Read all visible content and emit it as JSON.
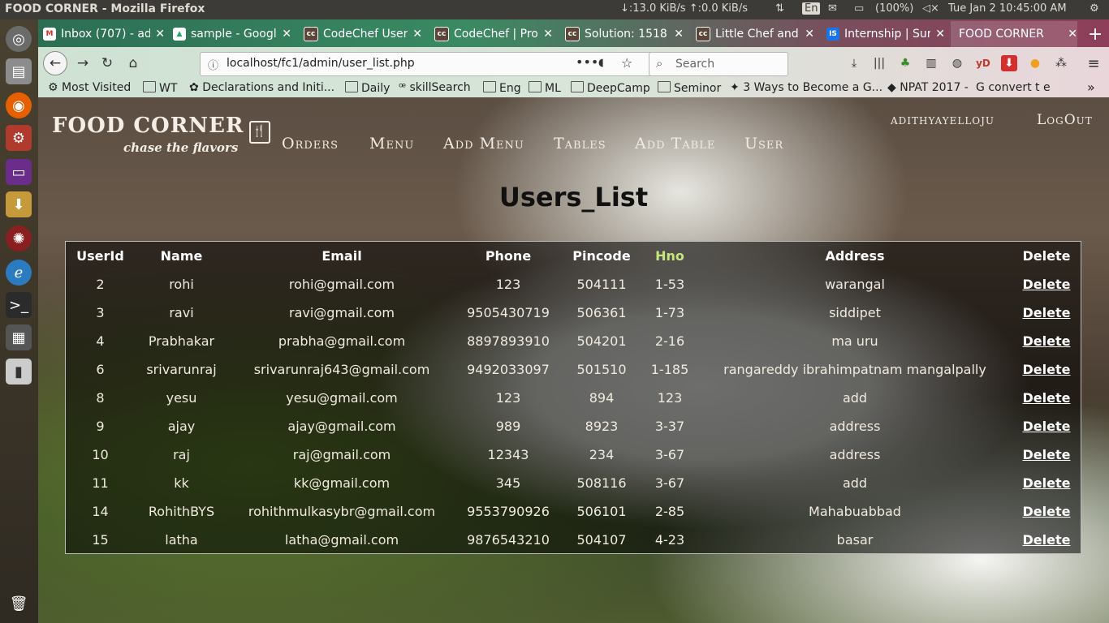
{
  "os": {
    "window_title": "FOOD CORNER - Mozilla Firefox",
    "network": "↓:13.0 KiB/s ↑:0.0 KiB/s",
    "keyboard": "En",
    "battery": "(100%)",
    "clock": "Tue Jan 2   10:45:00 AM"
  },
  "tabs": [
    {
      "label": "Inbox (707) - ad",
      "fav": "M",
      "color": "#ffffff",
      "fg": "#d93025"
    },
    {
      "label": "sample - Googl",
      "fav": "▲",
      "color": "#ffffff",
      "fg": "#1fa463"
    },
    {
      "label": "CodeChef User",
      "fav": "cc",
      "color": "#5b4638",
      "fg": "#ffffff"
    },
    {
      "label": "CodeChef | Pro",
      "fav": "cc",
      "color": "#5b4638",
      "fg": "#ffffff"
    },
    {
      "label": "Solution: 1518",
      "fav": "cc",
      "color": "#5b4638",
      "fg": "#ffffff"
    },
    {
      "label": "Little Chef and",
      "fav": "cc",
      "color": "#5b4638",
      "fg": "#ffffff"
    },
    {
      "label": "Internship | Sur",
      "fav": "IS",
      "color": "#1a73e8",
      "fg": "#ffffff"
    },
    {
      "label": "FOOD CORNER",
      "fav": "",
      "color": "",
      "fg": ""
    }
  ],
  "browser": {
    "url": "localhost/fc1/admin/user_list.php",
    "search_placeholder": "Search"
  },
  "bookmarks": [
    "Most Visited",
    "WT",
    "Declarations and Initi...",
    "Daily",
    "skillSearch",
    "Eng",
    "ML",
    "DeepCamp",
    "Seminor",
    "3 Ways to Become a G...",
    "NPAT 2017 -",
    "convert t e"
  ],
  "site": {
    "logo_line1": "FOOD CORNER",
    "logo_line2": "chase the flavors",
    "menu": [
      "Orders",
      "Menu",
      "Add Menu",
      "Tables",
      "Add Table",
      "User"
    ],
    "username": "adithyayelloju",
    "logout": "LogOut",
    "heading": "Users_List"
  },
  "table": {
    "headers": [
      "UserId",
      "Name",
      "Email",
      "Phone",
      "Pincode",
      "Hno",
      "Address",
      "Delete"
    ],
    "hno_header_color": "#c5e87a",
    "rows": [
      [
        "2",
        "rohi",
        "rohi@gmail.com",
        "123",
        "504111",
        "1-53",
        "warangal",
        "Delete"
      ],
      [
        "3",
        "ravi",
        "ravi@gmail.com",
        "9505430719",
        "506361",
        "1-73",
        "siddipet",
        "Delete"
      ],
      [
        "4",
        "Prabhakar",
        "prabha@gmail.com",
        "8897893910",
        "504201",
        "2-16",
        "ma uru",
        "Delete"
      ],
      [
        "6",
        "srivarunraj",
        "srivarunraj643@gmail.com",
        "9492033097",
        "501510",
        "1-185",
        "rangareddy ibrahimpatnam mangalpally",
        "Delete"
      ],
      [
        "8",
        "yesu",
        "yesu@gmail.com",
        "123",
        "894",
        "123",
        "add",
        "Delete"
      ],
      [
        "9",
        "ajay",
        "ajay@gmail.com",
        "989",
        "8923",
        "3-37",
        "address",
        "Delete"
      ],
      [
        "10",
        "raj",
        "raj@gmail.com",
        "12343",
        "234",
        "3-67",
        "address",
        "Delete"
      ],
      [
        "11",
        "kk",
        "kk@gmail.com",
        "345",
        "508116",
        "3-67",
        "add",
        "Delete"
      ],
      [
        "14",
        "RohithBYS",
        "rohithmulkasybr@gmail.com",
        "9553790926",
        "506101",
        "2-85",
        "Mahabuabbad",
        "Delete"
      ],
      [
        "15",
        "latha",
        "latha@gmail.com",
        "9876543210",
        "504107",
        "4-23",
        "basar",
        "Delete"
      ]
    ]
  }
}
